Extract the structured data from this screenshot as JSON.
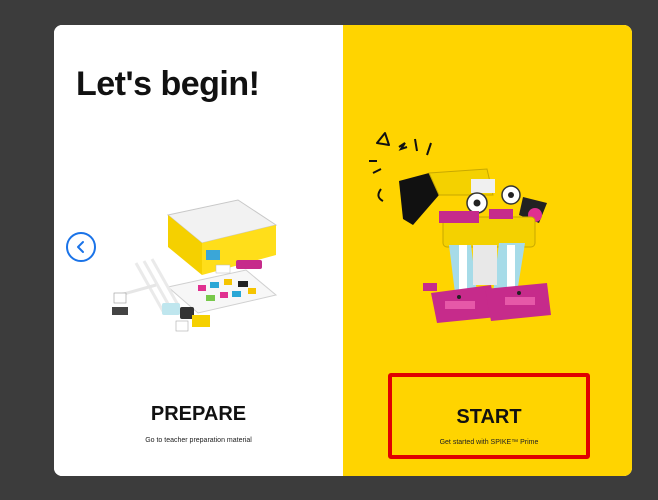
{
  "header": {
    "title": "Let's begin!"
  },
  "navigation": {
    "back_icon": "chevron-left-icon"
  },
  "prepare": {
    "title": "PREPARE",
    "subtitle": "Go to teacher preparation material"
  },
  "start": {
    "title": "START",
    "subtitle": "Get started with SPIKE™ Prime"
  },
  "colors": {
    "background": "#3c3c3c",
    "card_left": "#ffffff",
    "card_right": "#ffd400",
    "highlight": "#e00000",
    "accent": "#1a73e8"
  }
}
